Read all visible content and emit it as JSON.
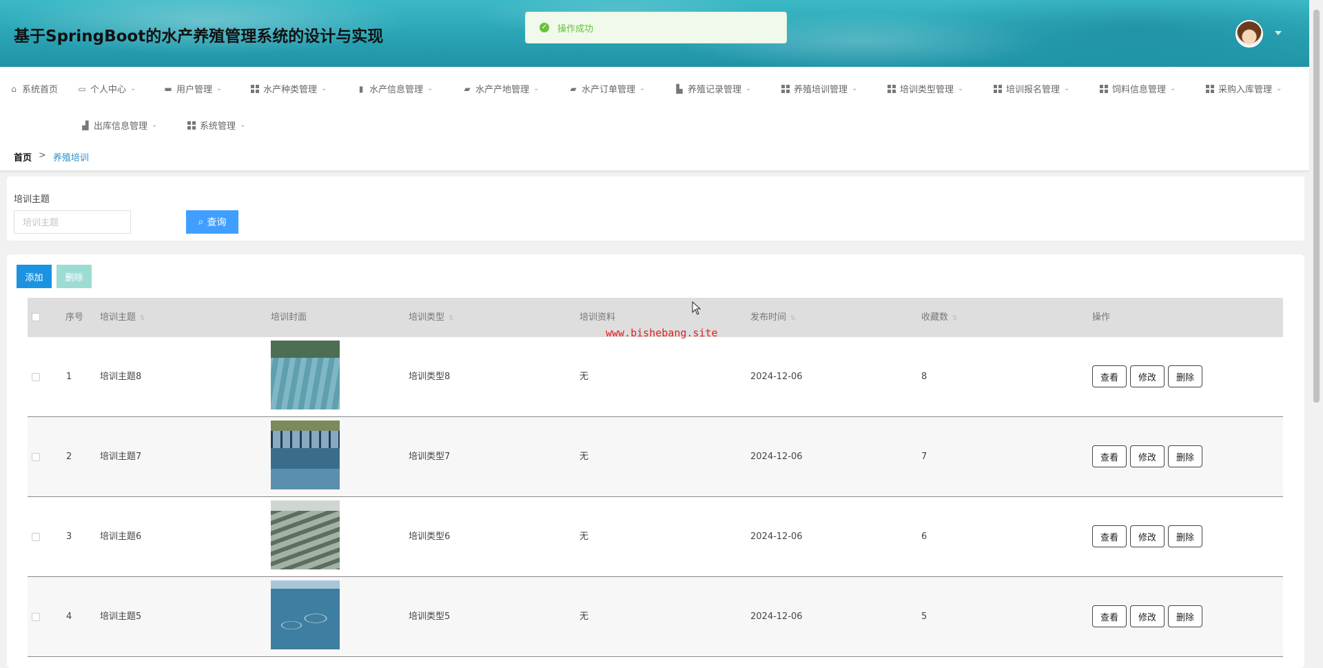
{
  "header": {
    "title": "基于SpringBoot的水产养殖管理系统的设计与实现",
    "toast_message": "操作成功"
  },
  "nav": {
    "items": [
      {
        "label": "系统首页",
        "icon": "home-icon"
      },
      {
        "label": "个人中心",
        "icon": "user-card-icon"
      },
      {
        "label": "用户管理",
        "icon": "chat-icon"
      },
      {
        "label": "水产种类管理",
        "icon": "grid-icon"
      },
      {
        "label": "水产信息管理",
        "icon": "document-icon"
      },
      {
        "label": "水产产地管理",
        "icon": "location-icon"
      },
      {
        "label": "水产订单管理",
        "icon": "briefcase-icon"
      },
      {
        "label": "养殖记录管理",
        "icon": "building-icon"
      },
      {
        "label": "养殖培训管理",
        "icon": "grid-icon"
      },
      {
        "label": "培训类型管理",
        "icon": "grid-icon"
      },
      {
        "label": "培训报名管理",
        "icon": "grid-icon"
      },
      {
        "label": "饲料信息管理",
        "icon": "grid-icon"
      },
      {
        "label": "采购入库管理",
        "icon": "grid-icon"
      },
      {
        "label": "出库信息管理",
        "icon": "bar-chart-icon"
      },
      {
        "label": "系统管理",
        "icon": "grid-icon"
      }
    ]
  },
  "breadcrumb": {
    "home": "首页",
    "separator": ">",
    "current": "养殖培训"
  },
  "search": {
    "label": "培训主题",
    "placeholder": "培训主题",
    "query_label": "查询"
  },
  "actions": {
    "add_label": "添加",
    "delete_label": "删除"
  },
  "table": {
    "headers": {
      "index": "序号",
      "topic": "培训主题",
      "cover": "培训封面",
      "type": "培训类型",
      "material": "培训资料",
      "publish_date": "发布时间",
      "favorites": "收藏数",
      "operations": "操作"
    },
    "row_buttons": {
      "view": "查看",
      "edit": "修改",
      "delete": "删除"
    },
    "rows": [
      {
        "index": "1",
        "topic": "培训主题8",
        "type": "培训类型8",
        "material": "无",
        "publish_date": "2024-12-06",
        "favorites": "8"
      },
      {
        "index": "2",
        "topic": "培训主题7",
        "type": "培训类型7",
        "material": "无",
        "publish_date": "2024-12-06",
        "favorites": "7"
      },
      {
        "index": "3",
        "topic": "培训主题6",
        "type": "培训类型6",
        "material": "无",
        "publish_date": "2024-12-06",
        "favorites": "6"
      },
      {
        "index": "4",
        "topic": "培训主题5",
        "type": "培训类型5",
        "material": "无",
        "publish_date": "2024-12-06",
        "favorites": "5"
      }
    ]
  },
  "watermark": "www.bishebang.site",
  "colors": {
    "header_teal": "#2aa5b6",
    "primary_blue": "#409eff",
    "add_blue": "#1c93e0",
    "delete_disabled": "#9ddcd3",
    "success_green": "#67c23a",
    "breadcrumb_link": "#2d8fc7",
    "watermark_red": "#e02020"
  }
}
